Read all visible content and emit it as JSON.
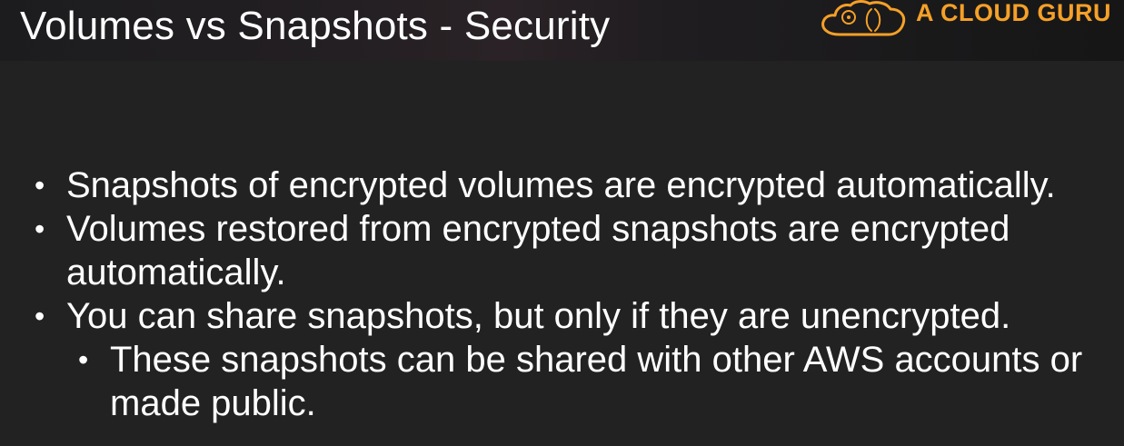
{
  "slide": {
    "title": "Volumes vs Snapshots - Security",
    "logo": {
      "text": "A CLOUD GURU",
      "icon": "cloud-icon",
      "color": "#f5a028"
    },
    "bullets": [
      {
        "level": 1,
        "text": "Snapshots of encrypted volumes are encrypted automatically."
      },
      {
        "level": 1,
        "text": "Volumes restored from encrypted snapshots are encrypted automatically."
      },
      {
        "level": 1,
        "text": "You can share snapshots, but only if they are unencrypted."
      },
      {
        "level": 2,
        "text": "These snapshots can be shared with other AWS accounts or made public."
      }
    ],
    "bullet_glyph": "•"
  },
  "colors": {
    "background": "#222222",
    "text": "#ffffff",
    "accent": "#f5a028"
  }
}
